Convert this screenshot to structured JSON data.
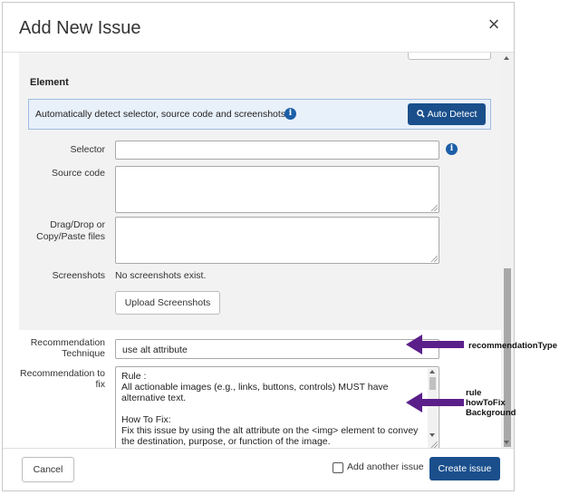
{
  "dialog": {
    "title": "Add New Issue",
    "close_symbol": "×"
  },
  "element_section": {
    "heading": "Element",
    "detect_text": "Automatically detect selector, source code and screenshots",
    "auto_detect_label": "Auto Detect",
    "auto_detect_icon": "search-icon",
    "info_icon": "info-icon",
    "info_glyph": "i",
    "selector_label": "Selector",
    "selector_value": "",
    "source_code_label": "Source code",
    "source_code_value": "",
    "dragdrop_label_line1": "Drag/Drop or",
    "dragdrop_label_line2": "Copy/Paste files",
    "screenshots_label": "Screenshots",
    "screenshots_status": "No screenshots exist.",
    "upload_label": "Upload Screenshots"
  },
  "recommendation": {
    "technique_label_line1": "Recommendation",
    "technique_label_line2": "Technique",
    "technique_value": "use alt attribute",
    "fix_label_line1": "Recommendation to",
    "fix_label_line2": "fix",
    "fix_text": "Rule :\nAll actionable images (e.g., links, buttons, controls) MUST have alternative text.\n\nHow To Fix:\nFix this issue by using the alt attribute on the <img> element to convey the destination, purpose, or function of the image."
  },
  "footer": {
    "cancel_label": "Cancel",
    "add_another_label": "Add another issue",
    "add_another_checked": false,
    "create_label": "Create issue"
  },
  "annotations": {
    "arrow_color": "#5b1f8a",
    "technique_note": "recommendationType",
    "fix_note_line1": "rule",
    "fix_note_line2": "howToFix",
    "fix_note_line3": "Background"
  },
  "colors": {
    "primary_button": "#1a4f8c",
    "detect_box_bg": "#e8f0fa",
    "panel_bg": "#f2f2f2"
  }
}
